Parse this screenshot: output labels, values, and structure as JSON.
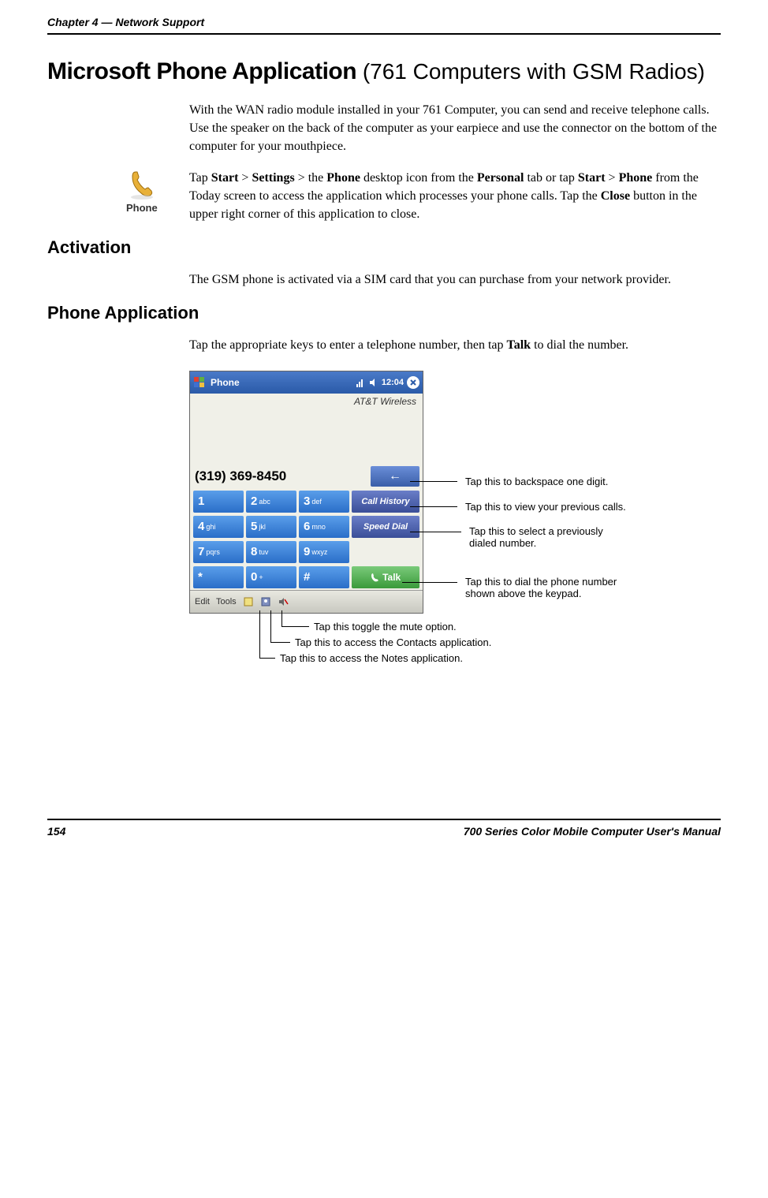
{
  "header": {
    "left": "Chapter 4  —  Network Support"
  },
  "title": {
    "bold": "Microsoft Phone Application",
    "light": " (761 Computers with GSM Radios)"
  },
  "para1": "With the WAN radio module installed in your 761 Computer, you can send and receive telephone calls. Use the speaker on the back of the computer as your earpiece and use the connector on the bottom of the computer for your mouthpiece.",
  "iconRow": {
    "iconLabel": "Phone",
    "text_pre": "Tap ",
    "b1": "Start",
    "gt1": " > ",
    "b2": "Settings",
    "gt2": " > the ",
    "b3": "Phone",
    "t2": " desktop icon from the ",
    "b4": "Personal",
    "t3": " tab or tap ",
    "b5": "Start",
    "gt3": " > ",
    "b6": "Phone",
    "t4": "  from the Today screen to access the application which processes your phone calls. Tap the ",
    "b7": "Close",
    "t5": " button in the upper right corner of this application to close."
  },
  "sec1": {
    "heading": "Activation",
    "body": "The GSM phone is activated via a SIM card that you can purchase from your network provider."
  },
  "sec2": {
    "heading": "Phone Application",
    "body_pre": "Tap the appropriate keys to enter a telephone number, then tap ",
    "body_bold": "Talk",
    "body_post": " to dial the number."
  },
  "phoneWin": {
    "title": "Phone",
    "time": "12:04",
    "carrier": "AT&T Wireless",
    "number": "(319) 369-8450",
    "backspace": "←",
    "keys": {
      "r1": [
        "1",
        "2abc",
        "3def"
      ],
      "r2": [
        "4ghi",
        "5jkl",
        "6mno"
      ],
      "r3": [
        "7pqrs",
        "8tuv",
        "9wxyz"
      ],
      "r4": [
        "*",
        "0+",
        "#"
      ]
    },
    "callHistory": "Call History",
    "speedDial": "Speed Dial",
    "talk": "Talk",
    "edit": "Edit",
    "tools": "Tools"
  },
  "callouts": {
    "backspace": "Tap this to backspace one digit.",
    "callHistory": "Tap this to view your previous calls.",
    "speedDial1": "Tap this to select a previously",
    "speedDial2": "dialed number.",
    "talk1": "Tap this to dial the phone number",
    "talk2": "shown above the keypad.",
    "mute": "Tap this toggle the mute option.",
    "contacts": "Tap this to access the Contacts application.",
    "notes": "Tap this to access the Notes application."
  },
  "footer": {
    "left": "154",
    "right": "700 Series Color Mobile Computer User's Manual"
  }
}
